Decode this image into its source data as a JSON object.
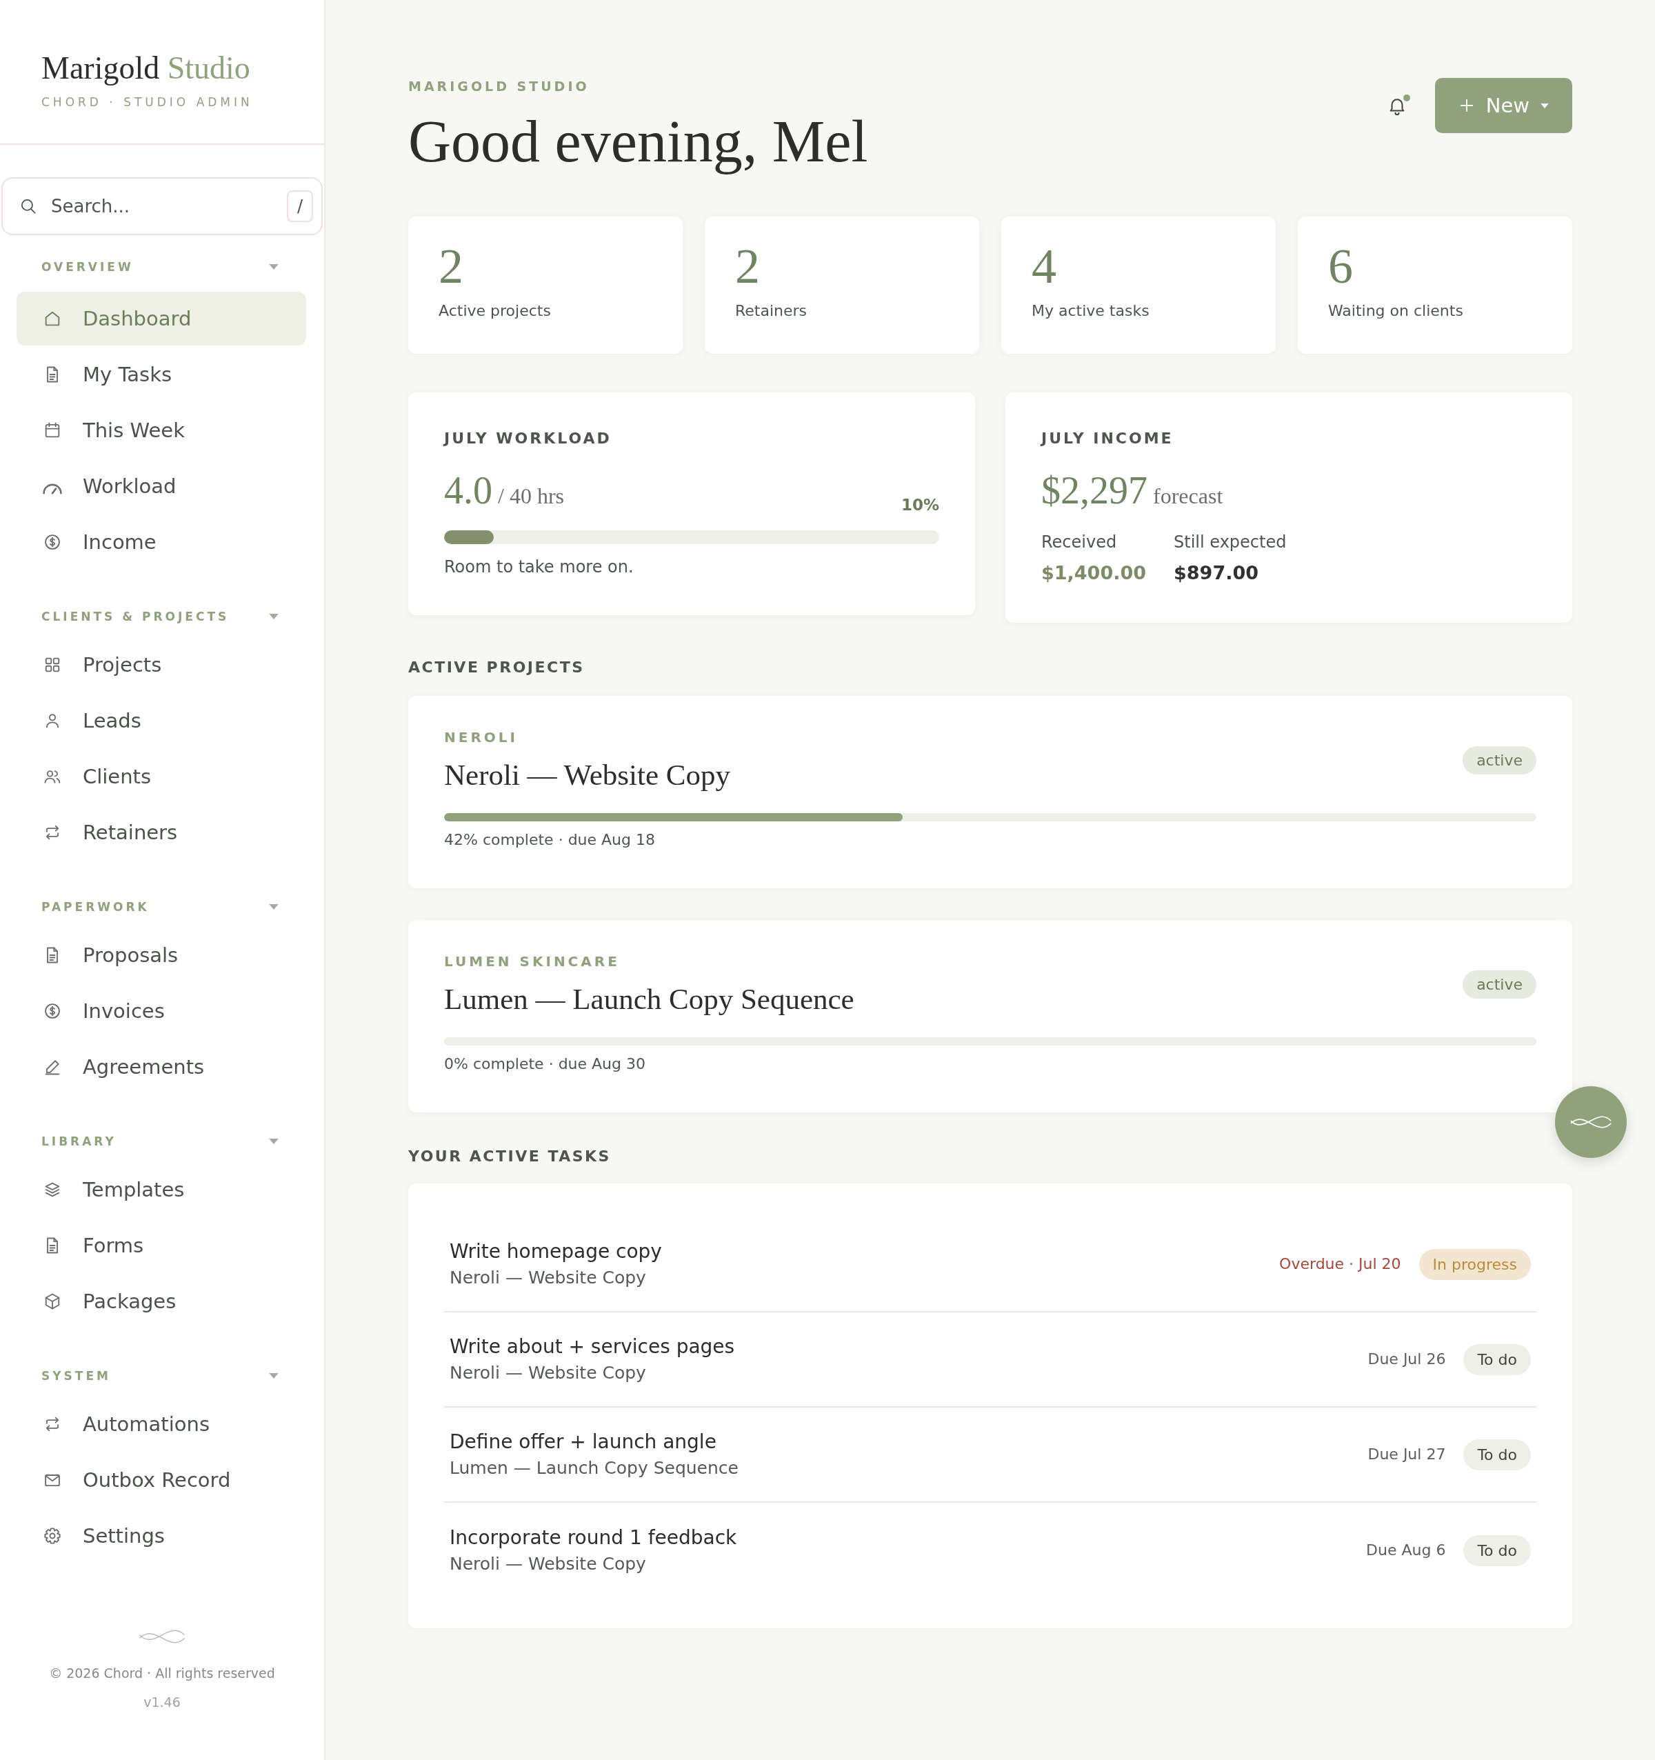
{
  "sidebar": {
    "brand": {
      "name": "Marigold",
      "accent": "Studio",
      "tagline": "CHORD · STUDIO ADMIN"
    },
    "search": {
      "placeholder": "Search...",
      "shortcut": "/"
    },
    "sections": [
      {
        "title": "OVERVIEW",
        "expanded": true,
        "items": [
          {
            "label": "Dashboard",
            "selected": true
          },
          {
            "label": "My Tasks",
            "selected": false
          },
          {
            "label": "This Week",
            "selected": false
          },
          {
            "label": "Workload",
            "selected": false
          },
          {
            "label": "Income",
            "selected": false
          }
        ]
      },
      {
        "title": "CLIENTS & PROJECTS",
        "expanded": true,
        "items": [
          {
            "label": "Projects",
            "selected": false
          },
          {
            "label": "Leads",
            "selected": false
          },
          {
            "label": "Clients",
            "selected": false
          },
          {
            "label": "Retainers",
            "selected": false
          }
        ]
      },
      {
        "title": "PAPERWORK",
        "expanded": true,
        "items": [
          {
            "label": "Proposals",
            "selected": false
          },
          {
            "label": "Invoices",
            "selected": false
          },
          {
            "label": "Agreements",
            "selected": false
          }
        ]
      },
      {
        "title": "LIBRARY",
        "expanded": true,
        "items": [
          {
            "label": "Templates",
            "selected": false
          },
          {
            "label": "Forms",
            "selected": false
          },
          {
            "label": "Packages",
            "selected": false
          }
        ]
      },
      {
        "title": "SYSTEM",
        "expanded": true,
        "items": [
          {
            "label": "Automations",
            "selected": false
          },
          {
            "label": "Outbox Record",
            "selected": false
          },
          {
            "label": "Settings",
            "selected": false
          }
        ]
      }
    ],
    "footer": {
      "copyright": "© 2026 Chord · All rights reserved",
      "version": "v1.46"
    }
  },
  "header": {
    "eyebrow": "MARIGOLD STUDIO",
    "greeting": "Good evening, Mel",
    "notifications": {
      "unread": true
    },
    "new_button": "New"
  },
  "stats": [
    {
      "value": "2",
      "label": "Active projects"
    },
    {
      "value": "2",
      "label": "Retainers"
    },
    {
      "value": "4",
      "label": "My active tasks"
    },
    {
      "value": "6",
      "label": "Waiting on clients"
    }
  ],
  "workload": {
    "title": "JULY WORKLOAD",
    "hours": "4.0",
    "capacity": "/ 40 hrs",
    "percent": "10%",
    "level": 0.1,
    "note": "Room to take more on."
  },
  "income": {
    "title": "JULY INCOME",
    "forecast": "$2,297",
    "forecast_label": "forecast",
    "received_label": "Received",
    "received": "$1,400.00",
    "expected_label": "Still expected",
    "expected": "$897.00"
  },
  "projects": {
    "heading": "ACTIVE PROJECTS",
    "items": [
      {
        "client": "NEROLI",
        "title": "Neroli — Website Copy",
        "status": "active",
        "level": 0.42,
        "progress": "42% complete · due Aug 18"
      },
      {
        "client": "LUMEN SKINCARE",
        "title": "Lumen — Launch Copy Sequence",
        "status": "active",
        "progress": "0% complete · due Aug 30"
      }
    ]
  },
  "tasks": {
    "heading": "YOUR ACTIVE TASKS",
    "items": [
      {
        "title": "Write homepage copy",
        "project": "Neroli — Website Copy",
        "due": "Overdue · Jul 20",
        "overdue": true,
        "status": "In progress",
        "kind": "progress"
      },
      {
        "title": "Write about + services pages",
        "project": "Neroli — Website Copy",
        "due": "Due Jul 26",
        "overdue": false,
        "status": "To do",
        "kind": "todo"
      },
      {
        "title": "Define offer + launch angle",
        "project": "Lumen — Launch Copy Sequence",
        "due": "Due Jul 27",
        "overdue": false,
        "status": "To do",
        "kind": "todo"
      },
      {
        "title": "Incorporate round 1 feedback",
        "project": "Neroli — Website Copy",
        "due": "Due Aug 6",
        "overdue": false,
        "status": "To do",
        "kind": "todo"
      }
    ]
  }
}
